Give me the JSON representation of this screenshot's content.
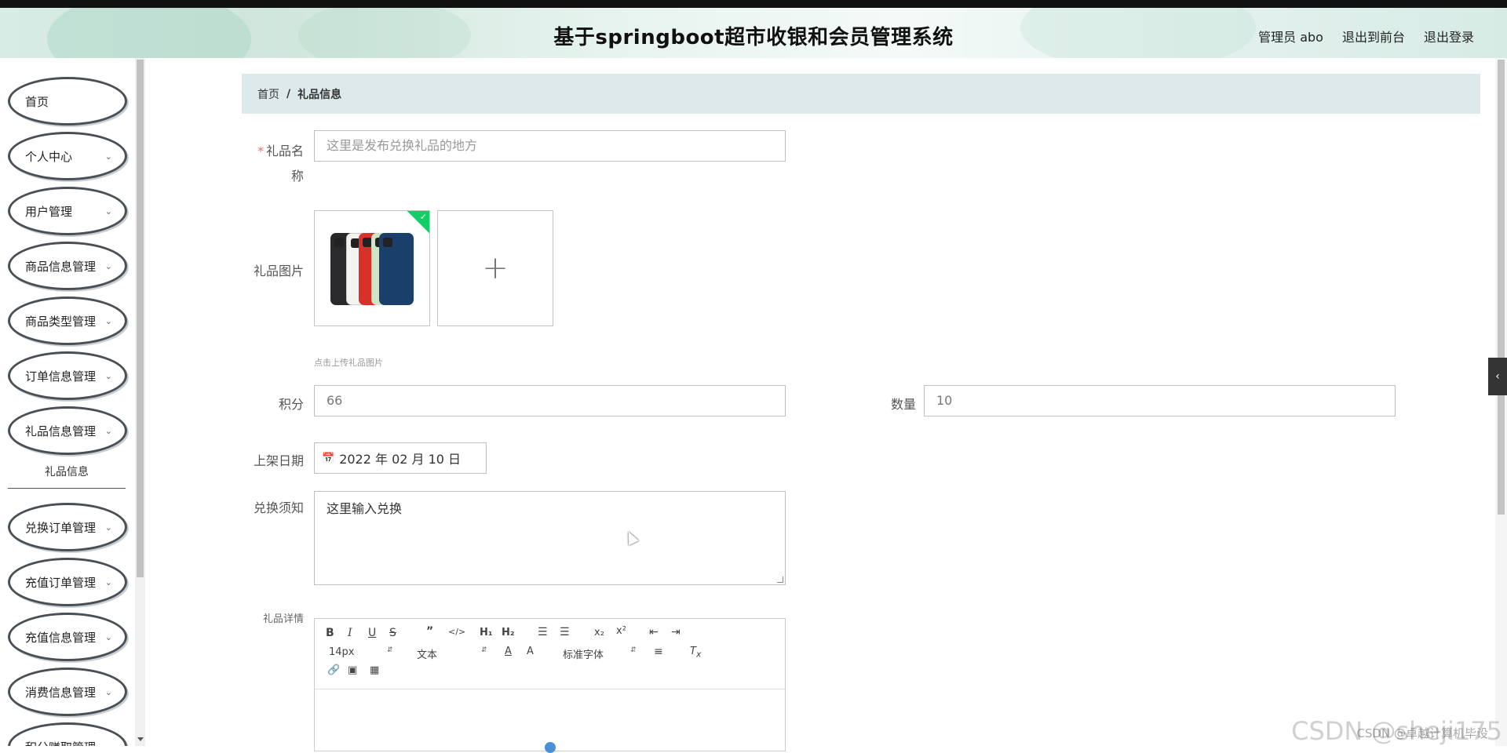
{
  "header": {
    "title": "基于springboot超市收银和会员管理系统",
    "user_label": "管理员 abo",
    "to_front_label": "退出到前台",
    "logout_label": "退出登录"
  },
  "sidebar": {
    "items": [
      {
        "label": "首页"
      },
      {
        "label": "个人中心"
      },
      {
        "label": "用户管理"
      },
      {
        "label": "商品信息管理"
      },
      {
        "label": "商品类型管理"
      },
      {
        "label": "订单信息管理"
      },
      {
        "label": "礼品信息管理"
      },
      {
        "label": "兑换订单管理"
      },
      {
        "label": "充值订单管理"
      },
      {
        "label": "充值信息管理"
      },
      {
        "label": "消费信息管理"
      },
      {
        "label": "积分赚取管理"
      }
    ],
    "submenu_active": "礼品信息"
  },
  "breadcrumb": {
    "home": "首页",
    "separator": "/",
    "current": "礼品信息"
  },
  "form": {
    "name_label_1": "礼品名",
    "name_label_2": "称",
    "name_placeholder": "这里是发布兑换礼品的地方",
    "image_label": "礼品图片",
    "image_tip": "点击上传礼品图片",
    "points_label": "积分",
    "points_value": "66",
    "quantity_label": "数量",
    "quantity_value": "10",
    "date_label": "上架日期",
    "date_value": "2022 年 02 月 10 日",
    "notice_label": "兑换须知",
    "notice_value": "这里输入兑换",
    "detail_label": "礼品详情"
  },
  "editor": {
    "font_size": "14px",
    "text_style": "文本",
    "font_family": "标准字体"
  },
  "watermark": {
    "big": "CSDN @sheji175",
    "small": "CSDN @卓越计算机毕设"
  }
}
